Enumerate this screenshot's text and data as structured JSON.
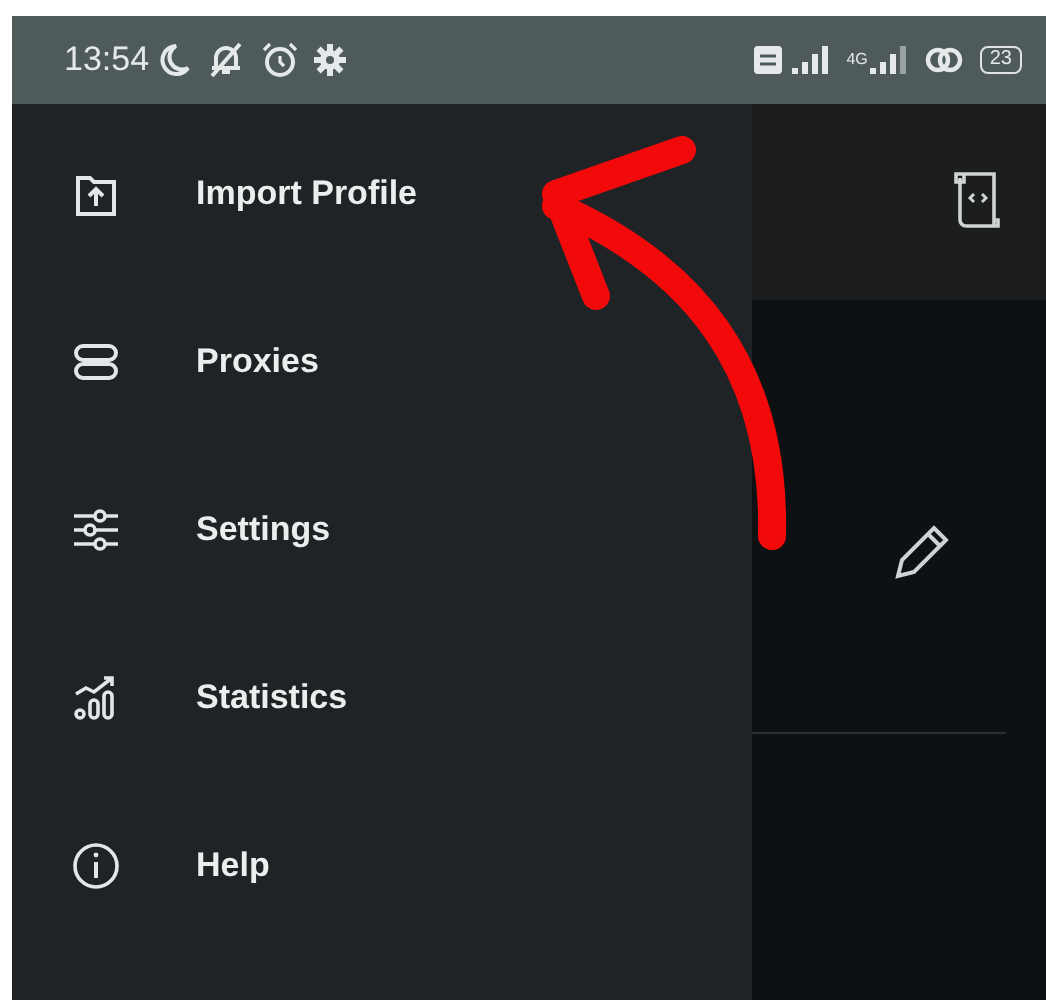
{
  "status_bar": {
    "time": "13:54",
    "network_type": "4G",
    "battery": "23"
  },
  "drawer": {
    "items": [
      {
        "label": "Import Profile",
        "kind": "import"
      },
      {
        "label": "Proxies",
        "kind": "proxies"
      },
      {
        "label": "Settings",
        "kind": "settings"
      },
      {
        "label": "Statistics",
        "kind": "statistics"
      },
      {
        "label": "Help",
        "kind": "help"
      }
    ]
  }
}
